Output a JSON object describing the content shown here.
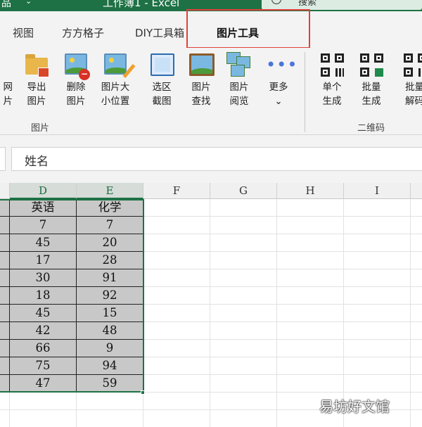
{
  "titlebar": {
    "app_char": "品",
    "doc_title": "工作簿1  -  Excel",
    "search_label": "搜索"
  },
  "tabs": [
    {
      "label": "视图"
    },
    {
      "label": "方方格子"
    },
    {
      "label": "DIY工具箱"
    },
    {
      "label": "图片工具",
      "active": true
    }
  ],
  "ribbon": {
    "partial_left": [
      "网",
      "片"
    ],
    "buttons": [
      {
        "line1": "导出",
        "line2": "图片",
        "icon": "export-picture-icon"
      },
      {
        "line1": "删除",
        "line2": "图片",
        "icon": "delete-picture-icon"
      },
      {
        "line1": "图片大",
        "line2": "小位置",
        "icon": "picture-size-icon"
      },
      {
        "line1": "选区",
        "line2": "截图",
        "icon": "screenshot-icon"
      },
      {
        "line1": "图片",
        "line2": "查找",
        "icon": "picture-find-icon"
      },
      {
        "line1": "图片",
        "line2": "阅览",
        "icon": "picture-browse-icon"
      },
      {
        "line1": "更多",
        "line2": "⌄",
        "icon": "more-icon"
      },
      {
        "line1": "单个",
        "line2": "生成",
        "icon": "qr-single-icon"
      },
      {
        "line1": "批量",
        "line2": "生成",
        "icon": "qr-batch-icon"
      },
      {
        "line1": "批量",
        "line2": "解码",
        "icon": "qr-decode-icon"
      }
    ],
    "groups": {
      "picture": "图片",
      "qrcode": "二维码"
    }
  },
  "formula_bar": {
    "value": "姓名"
  },
  "columns": [
    "D",
    "E",
    "F",
    "G",
    "H",
    "I"
  ],
  "table": {
    "headers": [
      "英语",
      "化学"
    ],
    "rows": [
      [
        "7",
        "7"
      ],
      [
        "45",
        "20"
      ],
      [
        "17",
        "28"
      ],
      [
        "30",
        "91"
      ],
      [
        "18",
        "92"
      ],
      [
        "45",
        "15"
      ],
      [
        "42",
        "48"
      ],
      [
        "66",
        "9"
      ],
      [
        "75",
        "94"
      ],
      [
        "47",
        "59"
      ]
    ]
  },
  "watermark": "易坊好文馆",
  "colors": {
    "accent": "#1e7145",
    "highlight": "#e0403a",
    "selection_fill": "#c8c8c8"
  }
}
